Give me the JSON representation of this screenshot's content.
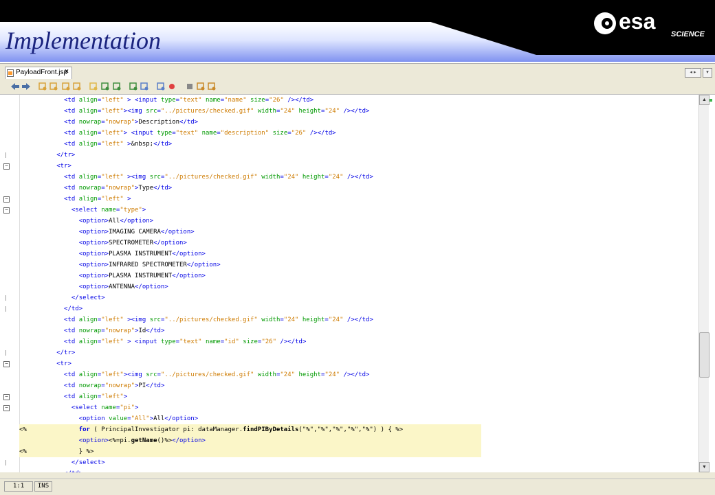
{
  "slide": {
    "title": "Implementation",
    "logo_word": "esa",
    "logo_sub": "SCIENCE"
  },
  "ide": {
    "tab_label": "PayloadFront.jsp",
    "tab_close": "×",
    "status_position": "1:1",
    "status_mode": "INS",
    "toolbar_icons": [
      "back-icon",
      "forward-icon",
      "find-icon",
      "find-selection-icon",
      "find-previous-icon",
      "find-next-icon",
      "toggle-highlight-icon",
      "previous-bookmark-icon",
      "next-bookmark-icon",
      "toggle-bookmark-icon",
      "shift-left-icon",
      "shift-right-icon",
      "start-macro-icon",
      "stop-macro-icon",
      "comment-icon",
      "uncomment-icon"
    ]
  },
  "code_lines": [
    "            <td align=\"left\" > <input type=\"text\" name=\"name\" size=\"26\" /></td>",
    "            <td align=\"left\"><img src=\"../pictures/checked.gif\" width=\"24\" height=\"24\" /></td>",
    "            <td nowrap=\"nowrap\">Description</td>",
    "            <td align=\"left\"> <input type=\"text\" name=\"description\" size=\"26\" /></td>",
    "            <td align=\"left\" >&nbsp;</td>",
    "          </tr>",
    "          <tr>",
    "            <td align=\"left\" ><img src=\"../pictures/checked.gif\" width=\"24\" height=\"24\" /></td>",
    "            <td nowrap=\"nowrap\">Type</td>",
    "            <td align=\"left\" >",
    "              <select name=\"type\">",
    "                <option>All</option>",
    "                <option>IMAGING CAMERA</option>",
    "                <option>SPECTROMETER</option>",
    "                <option>PLASMA INSTRUMENT</option>",
    "                <option>INFRARED SPECTROMETER</option>",
    "                <option>PLASMA INSTRUMENT</option>",
    "                <option>ANTENNA</option>",
    "              </select>",
    "            </td>",
    "            <td align=\"left\" ><img src=\"../pictures/checked.gif\" width=\"24\" height=\"24\" /></td>",
    "            <td nowrap=\"nowrap\">Id</td>",
    "            <td align=\"left\" > <input type=\"text\" name=\"id\" size=\"26\" /></td>",
    "          </tr>",
    "          <tr>",
    "            <td align=\"left\"><img src=\"../pictures/checked.gif\" width=\"24\" height=\"24\" /></td>",
    "            <td nowrap=\"nowrap\">PI</td>",
    "            <td align=\"left\">",
    "              <select name=\"pi\">",
    "                <option value=\"All\">All</option>",
    "<%              for ( PrincipalInvestigator pi: dataManager.findPIByDetails(\"%\",\"%\",\"%\",\"%\",\"%\") ) { %>",
    "                <option><%=pi.getName()%></option>",
    "<%              } %>",
    "              </select>",
    "            </td>"
  ],
  "highlight_lines": [
    30,
    31,
    32
  ],
  "fold_lines": [
    6,
    9,
    10,
    24,
    27,
    28
  ],
  "fold_end_lines": [
    5,
    18,
    19,
    23,
    33
  ]
}
